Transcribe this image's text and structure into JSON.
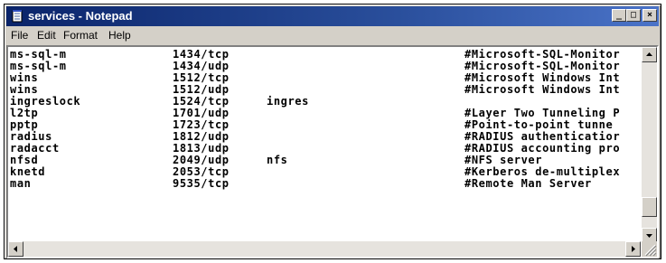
{
  "window": {
    "title": "services - Notepad"
  },
  "menu": {
    "items": [
      "File",
      "Edit",
      "Format",
      "Help"
    ]
  },
  "title_buttons": {
    "minimize": "_",
    "maximize": "□",
    "close": "×"
  },
  "lines": [
    {
      "name": "ms-sql-m",
      "port": "1434/tcp",
      "alias": "",
      "comment": "#Microsoft-SQL-Monitor"
    },
    {
      "name": "ms-sql-m",
      "port": "1434/udp",
      "alias": "",
      "comment": "#Microsoft-SQL-Monitor"
    },
    {
      "name": "wins",
      "port": "1512/tcp",
      "alias": "",
      "comment": "#Microsoft Windows Int"
    },
    {
      "name": "wins",
      "port": "1512/udp",
      "alias": "",
      "comment": "#Microsoft Windows Int"
    },
    {
      "name": "ingreslock",
      "port": "1524/tcp",
      "alias": "ingres",
      "comment": ""
    },
    {
      "name": "l2tp",
      "port": "1701/udp",
      "alias": "",
      "comment": "#Layer Two Tunneling P"
    },
    {
      "name": "pptp",
      "port": "1723/tcp",
      "alias": "",
      "comment": "#Point-to-point tunne"
    },
    {
      "name": "radius",
      "port": "1812/udp",
      "alias": "",
      "comment": "#RADIUS authenticatior"
    },
    {
      "name": "radacct",
      "port": "1813/udp",
      "alias": "",
      "comment": "#RADIUS accounting pro"
    },
    {
      "name": "nfsd",
      "port": "2049/udp",
      "alias": "nfs",
      "comment": "#NFS server"
    },
    {
      "name": "knetd",
      "port": "2053/tcp",
      "alias": "",
      "comment": "#Kerberos de-multiplex"
    },
    {
      "name": "man",
      "port": "9535/tcp",
      "alias": "",
      "comment": "#Remote Man Server"
    }
  ]
}
